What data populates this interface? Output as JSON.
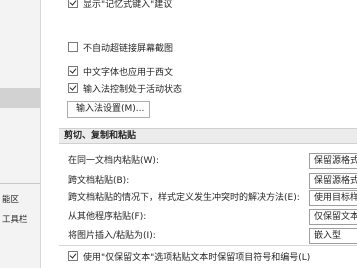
{
  "nav": {
    "items": [
      {
        "label": "",
        "selected": false
      },
      {
        "label": "",
        "selected": false
      },
      {
        "label": "",
        "selected": true
      },
      {
        "label": "",
        "selected": false
      },
      {
        "label": "",
        "selected": false
      },
      {
        "label": "",
        "selected": false
      },
      {
        "label": "",
        "selected": false
      },
      {
        "label": "能区",
        "selected": false
      },
      {
        "label": "工具栏",
        "selected": false
      }
    ]
  },
  "options": {
    "top_partial": "显示\"记忆式键入\"建议",
    "smart_link": "不自动超链接屏幕截图",
    "chinese_font_west": "中文字体也应用于西文",
    "ime_control": "输入法控制处于活动状态",
    "ime_settings_button": "输入法设置(M)..."
  },
  "paste_section": {
    "title": "剪切、复制和粘贴",
    "rows": [
      {
        "label": "在同一文档内粘贴(W):",
        "value": "保留源格式"
      },
      {
        "label": "跨文档粘贴(B):",
        "value": "保留源格式"
      },
      {
        "label": "跨文档粘贴的情况下，样式定义发生冲突时的解决方法(E):",
        "value": "使用目标样"
      },
      {
        "label": "从其他程序粘贴(F):",
        "value": "仅保留文本"
      },
      {
        "label": "将图片插入/粘贴为(I):",
        "value": "嵌入型"
      }
    ],
    "keep_bullets": "使用\"仅保留文本\"选项粘贴文本时保留项目符号和编号(L)"
  }
}
